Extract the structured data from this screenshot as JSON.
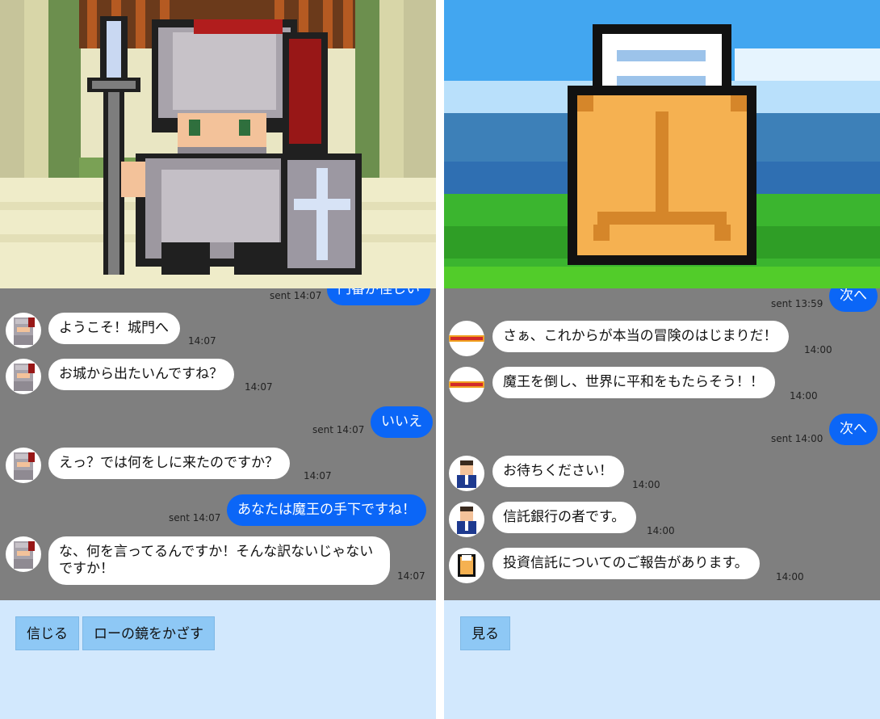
{
  "left": {
    "scene": "knight-guard-scene",
    "messages": [
      {
        "type": "out",
        "text": "門番が怪しい",
        "meta": "sent 14:07"
      },
      {
        "type": "in",
        "avatar": "knight-avatar",
        "text": "ようこそ！城門へ",
        "time": "14:07"
      },
      {
        "type": "in",
        "avatar": "knight-avatar",
        "text": "お城から出たいんですね？",
        "time": "14:07"
      },
      {
        "type": "out",
        "text": "いいえ",
        "meta": "sent 14:07"
      },
      {
        "type": "in",
        "avatar": "knight-avatar",
        "text": "えっ？では何をしに来たのですか？",
        "time": "14:07"
      },
      {
        "type": "out",
        "text": "あなたは魔王の手下ですね！",
        "meta": "sent 14:07"
      },
      {
        "type": "in",
        "avatar": "knight-avatar",
        "text": "な、何を言ってるんですか！そんな訳ないじゃないですか！",
        "time": "14:07"
      }
    ],
    "choices": [
      "信じる",
      "ローの鏡をかざす"
    ]
  },
  "right": {
    "scene": "envelope-letter-scene",
    "messages": [
      {
        "type": "out",
        "text": "次へ",
        "meta": "sent 13:59"
      },
      {
        "type": "in",
        "avatar": "congratulations-badge",
        "text": "さぁ、これからが本当の冒険のはじまりだ！",
        "time": "14:00"
      },
      {
        "type": "in",
        "avatar": "congratulations-badge",
        "text": "魔王を倒し、世界に平和をもたらそう！！",
        "time": "14:00"
      },
      {
        "type": "out",
        "text": "次へ",
        "meta": "sent 14:00"
      },
      {
        "type": "in",
        "avatar": "businessman-avatar",
        "text": "お待ちください！",
        "time": "14:00"
      },
      {
        "type": "in",
        "avatar": "businessman-avatar",
        "text": "信託銀行の者です。",
        "time": "14:00"
      },
      {
        "type": "in",
        "avatar": "envelope-avatar",
        "text": "投資信託についてのご報告があります。",
        "time": "14:00"
      }
    ],
    "choices": [
      "見る"
    ]
  },
  "colors": {
    "chat_bg": "#7f7f7f",
    "out_bubble": "#0b66f7",
    "in_bubble": "#ffffff",
    "choices_bg": "#d2e8fd",
    "choice_button": "#8ec8f5"
  }
}
